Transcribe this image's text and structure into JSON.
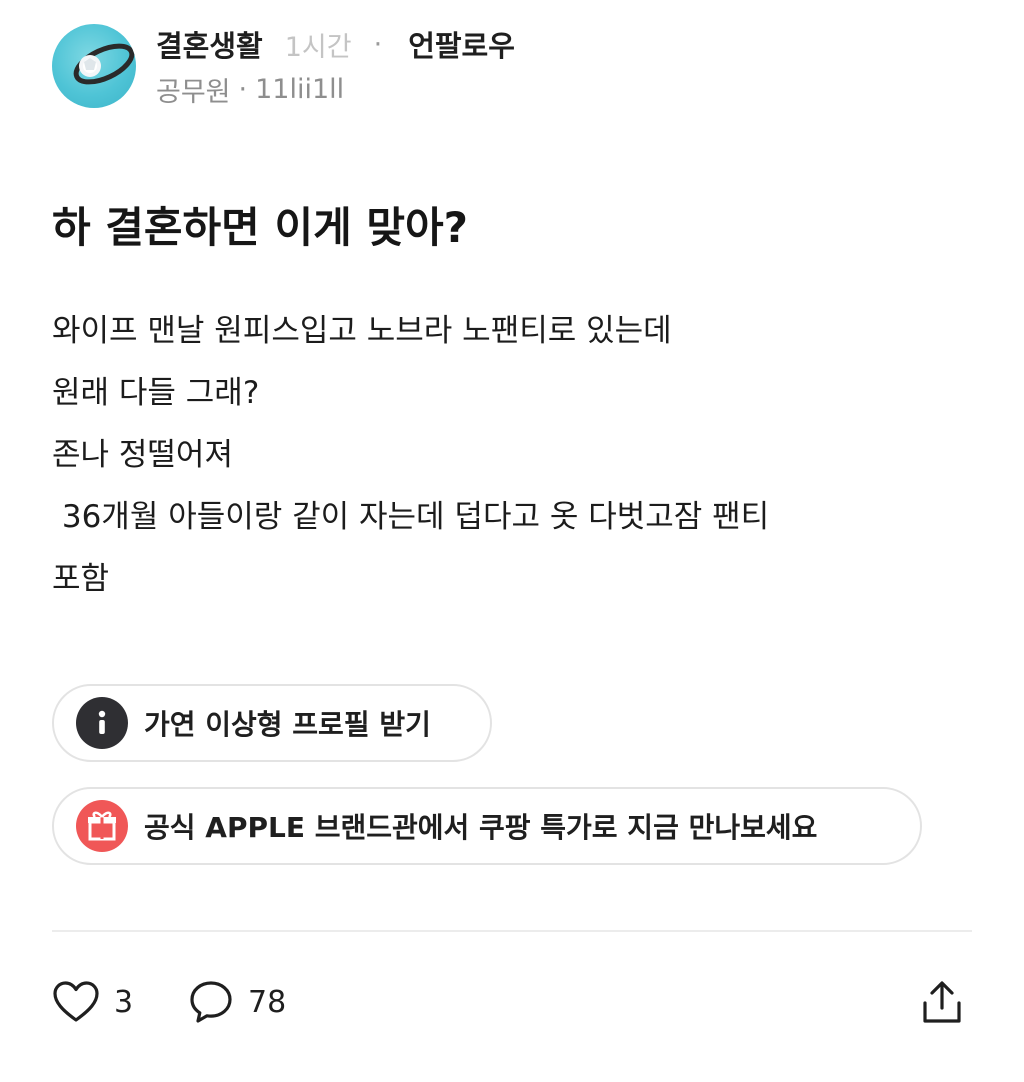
{
  "post": {
    "category": "결혼생활",
    "time": "1시간",
    "unfollow_label": "언팔로우",
    "author_job": "공무원",
    "author_separator": "·",
    "author_name": "11lii1ll",
    "avatar_icon": "ring-icon",
    "title": "하 결혼하면 이게 맞아?",
    "body_lines": [
      "와이프 맨날 원피스입고 노브라 노팬티로 있는데",
      "원래 다들 그래?",
      "존나 정떨어져",
      " 36개월 아들이랑 같이 자는데 덥다고 옷 다벗고잠 팬티",
      "포함"
    ]
  },
  "promos": [
    {
      "icon": "info-icon",
      "label": "가연 이상형 프로필 받기",
      "color": "#2f2f33"
    },
    {
      "icon": "gift-icon",
      "label": "공식 APPLE 브랜드관에서 쿠팡 특가로 지금 만나보세요",
      "color": "#f05757"
    }
  ],
  "actions": {
    "like_count": "3",
    "comment_count": "78",
    "like_icon": "heart-icon",
    "comment_icon": "comment-bubble-icon",
    "share_icon": "share-icon"
  }
}
